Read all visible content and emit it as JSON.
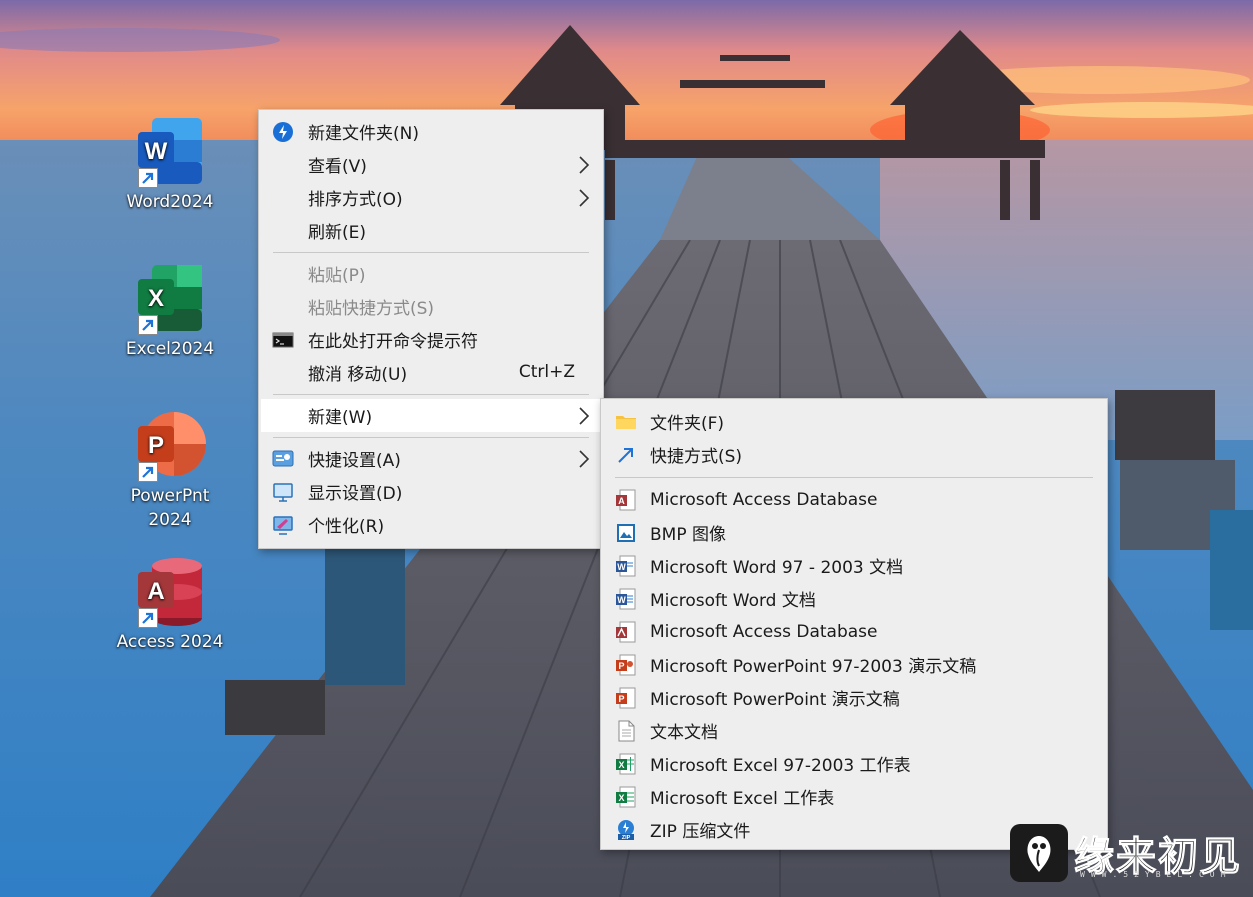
{
  "desktop": {
    "icons": [
      {
        "label": "Word2024",
        "icon": "word-icon",
        "color": "#2b7cd3"
      },
      {
        "label": "Excel2024",
        "icon": "excel-icon",
        "color": "#1e8a4c"
      },
      {
        "label": "PowerPnt 2024",
        "icon": "powerpoint-icon",
        "color": "#e0562f"
      },
      {
        "label": "Access 2024",
        "icon": "access-icon",
        "color": "#c2283a"
      }
    ]
  },
  "context_menu": {
    "items": [
      {
        "label": "新建文件夹(N)",
        "icon": "new-folder-icon"
      },
      {
        "label": "查看(V)",
        "submenu": true
      },
      {
        "label": "排序方式(O)",
        "submenu": true
      },
      {
        "label": "刷新(E)"
      },
      {
        "label": "粘贴(P)",
        "disabled": true
      },
      {
        "label": "粘贴快捷方式(S)",
        "disabled": true
      },
      {
        "label": "在此处打开命令提示符",
        "icon": "cmd-icon"
      },
      {
        "label": "撤消 移动(U)",
        "shortcut": "Ctrl+Z"
      },
      {
        "label": "新建(W)",
        "submenu": true,
        "highlighted": true
      },
      {
        "label": "快捷设置(A)",
        "submenu": true,
        "icon": "quick-settings-icon"
      },
      {
        "label": "显示设置(D)",
        "icon": "display-icon"
      },
      {
        "label": "个性化(R)",
        "icon": "personalize-icon"
      }
    ]
  },
  "new_submenu": {
    "items": [
      {
        "label": "文件夹(F)",
        "icon": "folder-icon"
      },
      {
        "label": "快捷方式(S)",
        "icon": "shortcut-icon"
      },
      {
        "label": "Microsoft Access Database",
        "icon": "access-file-icon"
      },
      {
        "label": "BMP 图像",
        "icon": "bmp-file-icon"
      },
      {
        "label": "Microsoft Word 97 - 2003 文档",
        "icon": "word-doc-icon"
      },
      {
        "label": "Microsoft Word 文档",
        "icon": "word-docx-icon"
      },
      {
        "label": "Microsoft Access Database",
        "icon": "access-file-icon"
      },
      {
        "label": "Microsoft PowerPoint 97-2003 演示文稿",
        "icon": "ppt-file-icon"
      },
      {
        "label": "Microsoft PowerPoint 演示文稿",
        "icon": "pptx-file-icon"
      },
      {
        "label": "文本文档",
        "icon": "text-file-icon"
      },
      {
        "label": "Microsoft Excel 97-2003 工作表",
        "icon": "xls-file-icon"
      },
      {
        "label": "Microsoft Excel 工作表",
        "icon": "xlsx-file-icon"
      },
      {
        "label": "ZIP 压缩文件",
        "icon": "zip-file-icon"
      }
    ]
  },
  "watermark": {
    "text": "缘来初见",
    "url": "WWW.52YBEL.COM"
  }
}
